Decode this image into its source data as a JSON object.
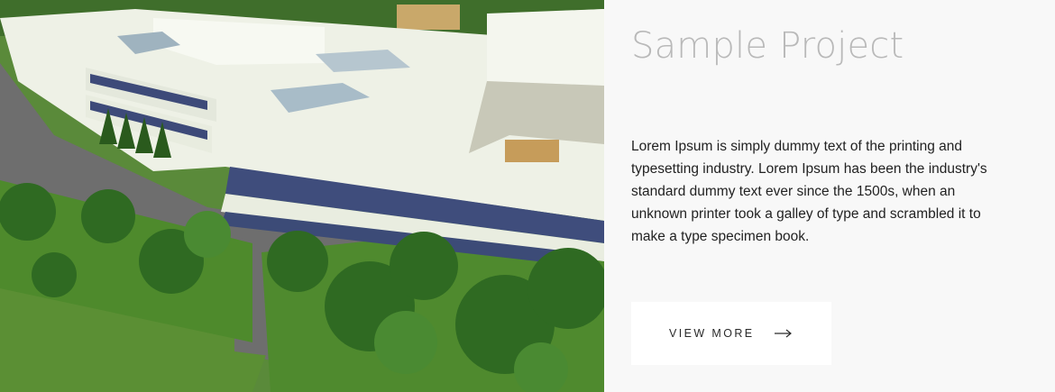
{
  "project": {
    "title": "Sample Project",
    "description": "Lorem Ipsum is simply dummy text of the printing and typesetting industry. Lorem Ipsum has been the industry's standard dummy text ever since the 1500s, when an unknown printer took a galley of type and scrambled it to make a type specimen book.",
    "cta_label": "VIEW MORE",
    "cta_icon": "arrow-right-icon",
    "image_subject": "aerial-building-render"
  },
  "colors": {
    "background": "#f8f8f8",
    "title": "#b9b9b9",
    "body_text": "#222222",
    "button_bg": "#ffffff"
  }
}
